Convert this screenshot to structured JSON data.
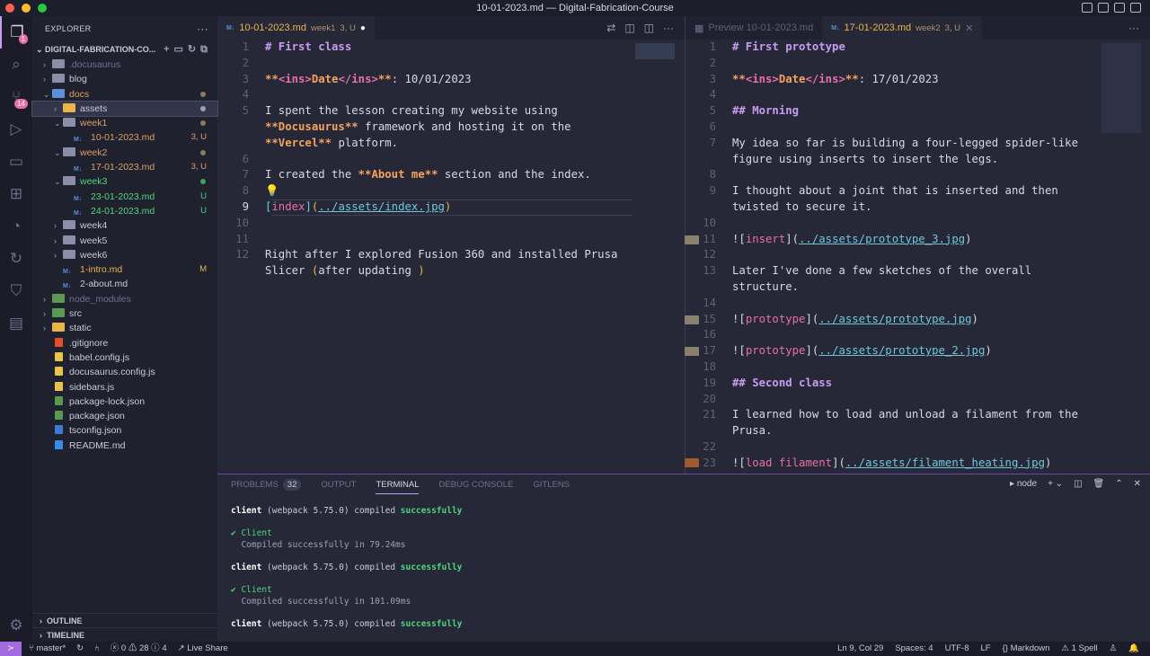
{
  "window": {
    "title": "10-01-2023.md — Digital-Fabrication-Course"
  },
  "activity": {
    "explorer_badge": "1",
    "scm_badge": "14"
  },
  "sidebar": {
    "title": "EXPLORER",
    "root": "DIGITAL-FABRICATION-CO...",
    "items": [
      {
        "label": ".docusaurus",
        "depth": 0,
        "type": "folder",
        "open": false,
        "color": "#6d7090"
      },
      {
        "label": "blog",
        "depth": 0,
        "type": "folder",
        "open": false,
        "color": "#c9cbd8"
      },
      {
        "label": "docs",
        "depth": 0,
        "type": "folder",
        "open": true,
        "color": "#d9a066",
        "dot": "#8a7a60",
        "icon": "#5b8fd8"
      },
      {
        "label": "assets",
        "depth": 1,
        "type": "folder",
        "open": false,
        "color": "#c9cbd8",
        "dot": "#9ea1b8",
        "selected": true,
        "icon": "#e8b44a"
      },
      {
        "label": "week1",
        "depth": 1,
        "type": "folder",
        "open": true,
        "color": "#d9a066",
        "dot": "#8a7a60"
      },
      {
        "label": "10-01-2023.md",
        "depth": 2,
        "type": "md",
        "color": "#d9a066",
        "status": "3, U"
      },
      {
        "label": "week2",
        "depth": 1,
        "type": "folder",
        "open": true,
        "color": "#d9a066",
        "dot": "#8a7a60"
      },
      {
        "label": "17-01-2023.md",
        "depth": 2,
        "type": "md",
        "color": "#d9a066",
        "status": "3, U"
      },
      {
        "label": "week3",
        "depth": 1,
        "type": "folder",
        "open": true,
        "color": "#4fd67a",
        "dot": "#3fa060"
      },
      {
        "label": "23-01-2023.md",
        "depth": 2,
        "type": "md",
        "color": "#4fd67a",
        "status": "U"
      },
      {
        "label": "24-01-2023.md",
        "depth": 2,
        "type": "md",
        "color": "#4fd67a",
        "status": "U"
      },
      {
        "label": "week4",
        "depth": 1,
        "type": "folder",
        "open": false,
        "color": "#c9cbd8"
      },
      {
        "label": "week5",
        "depth": 1,
        "type": "folder",
        "open": false,
        "color": "#c9cbd8"
      },
      {
        "label": "week6",
        "depth": 1,
        "type": "folder",
        "open": false,
        "color": "#c9cbd8"
      },
      {
        "label": "1-intro.md",
        "depth": 1,
        "type": "md",
        "color": "#e8b44a",
        "status": "M"
      },
      {
        "label": "2-about.md",
        "depth": 1,
        "type": "md",
        "color": "#c9cbd8"
      },
      {
        "label": "node_modules",
        "depth": 0,
        "type": "folder",
        "open": false,
        "color": "#6d7090",
        "icon": "#5a9a50"
      },
      {
        "label": "src",
        "depth": 0,
        "type": "folder",
        "open": false,
        "color": "#c9cbd8",
        "icon": "#5a9a50"
      },
      {
        "label": "static",
        "depth": 0,
        "type": "folder",
        "open": false,
        "color": "#c9cbd8",
        "icon": "#e8b44a"
      },
      {
        "label": ".gitignore",
        "depth": 0,
        "type": "file",
        "color": "#c9cbd8",
        "icon": "#e0502a"
      },
      {
        "label": "babel.config.js",
        "depth": 0,
        "type": "file",
        "color": "#c9cbd8",
        "icon": "#e8c44a"
      },
      {
        "label": "docusaurus.config.js",
        "depth": 0,
        "type": "file",
        "color": "#c9cbd8",
        "icon": "#e8c44a"
      },
      {
        "label": "sidebars.js",
        "depth": 0,
        "type": "file",
        "color": "#c9cbd8",
        "icon": "#e8c44a"
      },
      {
        "label": "package-lock.json",
        "depth": 0,
        "type": "file",
        "color": "#c9cbd8",
        "icon": "#5a9a50"
      },
      {
        "label": "package.json",
        "depth": 0,
        "type": "file",
        "color": "#c9cbd8",
        "icon": "#5a9a50"
      },
      {
        "label": "tsconfig.json",
        "depth": 0,
        "type": "file",
        "color": "#c9cbd8",
        "icon": "#3a7ad8"
      },
      {
        "label": "README.md",
        "depth": 0,
        "type": "file",
        "color": "#c9cbd8",
        "icon": "#3a8ae8"
      }
    ],
    "outline": "OUTLINE",
    "timeline": "TIMELINE"
  },
  "left_editor": {
    "tab": {
      "name": "10-01-2023.md",
      "folder": "week1",
      "status": "3, U"
    },
    "current_line": "9",
    "rows": [
      {
        "n": "1",
        "s": [
          [
            "# First class",
            "h"
          ]
        ]
      },
      {
        "n": "2",
        "s": []
      },
      {
        "n": "3",
        "s": [
          [
            "**",
            "b"
          ],
          [
            "<ins>",
            "tag"
          ],
          [
            "Date",
            "b"
          ],
          [
            "</ins>",
            "tag"
          ],
          [
            "**",
            "b"
          ],
          [
            ": 10/01/2023",
            "t"
          ]
        ]
      },
      {
        "n": "4",
        "s": []
      },
      {
        "n": "5",
        "s": [
          [
            "I spent the lesson creating my website using",
            "t"
          ]
        ]
      },
      {
        "n": "",
        "s": [
          [
            "**Docusaurus**",
            "b"
          ],
          [
            " framework and hosting it on the",
            "t"
          ]
        ]
      },
      {
        "n": "",
        "s": [
          [
            "**Vercel**",
            "b"
          ],
          [
            " platform.",
            "t"
          ]
        ]
      },
      {
        "n": "6",
        "s": []
      },
      {
        "n": "7",
        "s": [
          [
            "I created the ",
            "t"
          ],
          [
            "**About me**",
            "b"
          ],
          [
            " section and the index.",
            "t"
          ]
        ]
      },
      {
        "n": "8",
        "s": [
          [
            "💡",
            "p"
          ]
        ]
      },
      {
        "n": "9",
        "s": [
          [
            "[",
            "lt"
          ],
          [
            "index",
            "lk"
          ],
          [
            "]",
            "lt"
          ],
          [
            "(",
            "p"
          ],
          [
            "../assets/index.jpg",
            "url"
          ],
          [
            ")",
            "p"
          ]
        ]
      },
      {
        "n": "10",
        "s": []
      },
      {
        "n": "11",
        "s": []
      },
      {
        "n": "12",
        "s": [
          [
            "Right after I explored Fusion 360 and installed Prusa",
            "t"
          ]
        ]
      },
      {
        "n": "",
        "s": [
          [
            "Slicer ",
            "t"
          ],
          [
            "(",
            "p"
          ],
          [
            "after updating ",
            "t"
          ],
          [
            ")",
            "p"
          ]
        ]
      }
    ]
  },
  "right_editor": {
    "preview_tab": "Preview 10-01-2023.md",
    "tab": {
      "name": "17-01-2023.md",
      "folder": "week2",
      "status": "3, U"
    },
    "rows": [
      {
        "n": "1",
        "s": [
          [
            "# First prototype",
            "h"
          ]
        ]
      },
      {
        "n": "2",
        "s": []
      },
      {
        "n": "3",
        "s": [
          [
            "**",
            "b"
          ],
          [
            "<ins>",
            "tag"
          ],
          [
            "Date",
            "b"
          ],
          [
            "</ins>",
            "tag"
          ],
          [
            "**",
            "b"
          ],
          [
            ": 17/01/2023",
            "t"
          ]
        ]
      },
      {
        "n": "4",
        "s": []
      },
      {
        "n": "5",
        "s": [
          [
            "## Morning",
            "h"
          ]
        ]
      },
      {
        "n": "6",
        "s": []
      },
      {
        "n": "7",
        "s": [
          [
            "My idea so far is building a four-legged spider-like",
            "t"
          ]
        ]
      },
      {
        "n": "",
        "s": [
          [
            "figure using inserts to insert the legs.",
            "t"
          ]
        ]
      },
      {
        "n": "8",
        "s": []
      },
      {
        "n": "9",
        "s": [
          [
            "I thought about a joint that is inserted and then",
            "t"
          ]
        ]
      },
      {
        "n": "",
        "s": [
          [
            "twisted to secure it.",
            "t"
          ]
        ]
      },
      {
        "n": "10",
        "s": []
      },
      {
        "n": "11",
        "s": [
          [
            "![",
            "t"
          ],
          [
            "insert",
            "lk"
          ],
          [
            "](",
            "t"
          ],
          [
            "../assets/prototype_3.jpg",
            "url"
          ],
          [
            ")",
            "t"
          ]
        ]
      },
      {
        "n": "12",
        "s": []
      },
      {
        "n": "13",
        "s": [
          [
            "Later I've done a few sketches of the overall",
            "t"
          ]
        ]
      },
      {
        "n": "",
        "s": [
          [
            "structure.",
            "t"
          ]
        ]
      },
      {
        "n": "14",
        "s": []
      },
      {
        "n": "15",
        "s": [
          [
            "![",
            "t"
          ],
          [
            "prototype",
            "lk"
          ],
          [
            "](",
            "t"
          ],
          [
            "../assets/prototype.jpg",
            "url"
          ],
          [
            ")",
            "t"
          ]
        ]
      },
      {
        "n": "16",
        "s": []
      },
      {
        "n": "17",
        "s": [
          [
            "![",
            "t"
          ],
          [
            "prototype",
            "lk"
          ],
          [
            "](",
            "t"
          ],
          [
            "../assets/prototype_2.jpg",
            "url"
          ],
          [
            ")",
            "t"
          ]
        ]
      },
      {
        "n": "18",
        "s": []
      },
      {
        "n": "19",
        "s": [
          [
            "## Second class",
            "h"
          ]
        ]
      },
      {
        "n": "20",
        "s": []
      },
      {
        "n": "21",
        "s": [
          [
            "I learned how to load and unload a filament from the",
            "t"
          ]
        ]
      },
      {
        "n": "",
        "s": [
          [
            "Prusa.",
            "t"
          ]
        ]
      },
      {
        "n": "22",
        "s": []
      },
      {
        "n": "23",
        "s": [
          [
            "![",
            "t"
          ],
          [
            "load filament",
            "lk"
          ],
          [
            "](",
            "t"
          ],
          [
            "../assets/filament_heating.jpg",
            "url"
          ],
          [
            ")",
            "t"
          ]
        ]
      }
    ]
  },
  "panel": {
    "tabs": [
      "PROBLEMS",
      "OUTPUT",
      "TERMINAL",
      "DEBUG CONSOLE",
      "GITLENS"
    ],
    "problems_count": "32",
    "active": "TERMINAL",
    "shell": "node",
    "terminal": [
      {
        "k": "c",
        "a": "client",
        "b": " (webpack 5.75.0) compiled ",
        "c": "successfully"
      },
      {
        "k": "e"
      },
      {
        "k": "ok",
        "a": "✔ Client"
      },
      {
        "k": "d",
        "a": "  Compiled successfully in 79.24ms"
      },
      {
        "k": "e"
      },
      {
        "k": "c",
        "a": "client",
        "b": " (webpack 5.75.0) compiled ",
        "c": "successfully"
      },
      {
        "k": "e"
      },
      {
        "k": "ok",
        "a": "✔ Client"
      },
      {
        "k": "d",
        "a": "  Compiled successfully in 101.09ms"
      },
      {
        "k": "e"
      },
      {
        "k": "c",
        "a": "client",
        "b": " (webpack 5.75.0) compiled ",
        "c": "successfully"
      }
    ]
  },
  "status": {
    "branch": "master*",
    "errors": "0",
    "warnings": "28",
    "info": "4",
    "live_share": "Live Share",
    "position": "Ln 9, Col 29",
    "spaces": "Spaces: 4",
    "encoding": "UTF-8",
    "eol": "LF",
    "language": "Markdown",
    "spell": "1 Spell"
  }
}
